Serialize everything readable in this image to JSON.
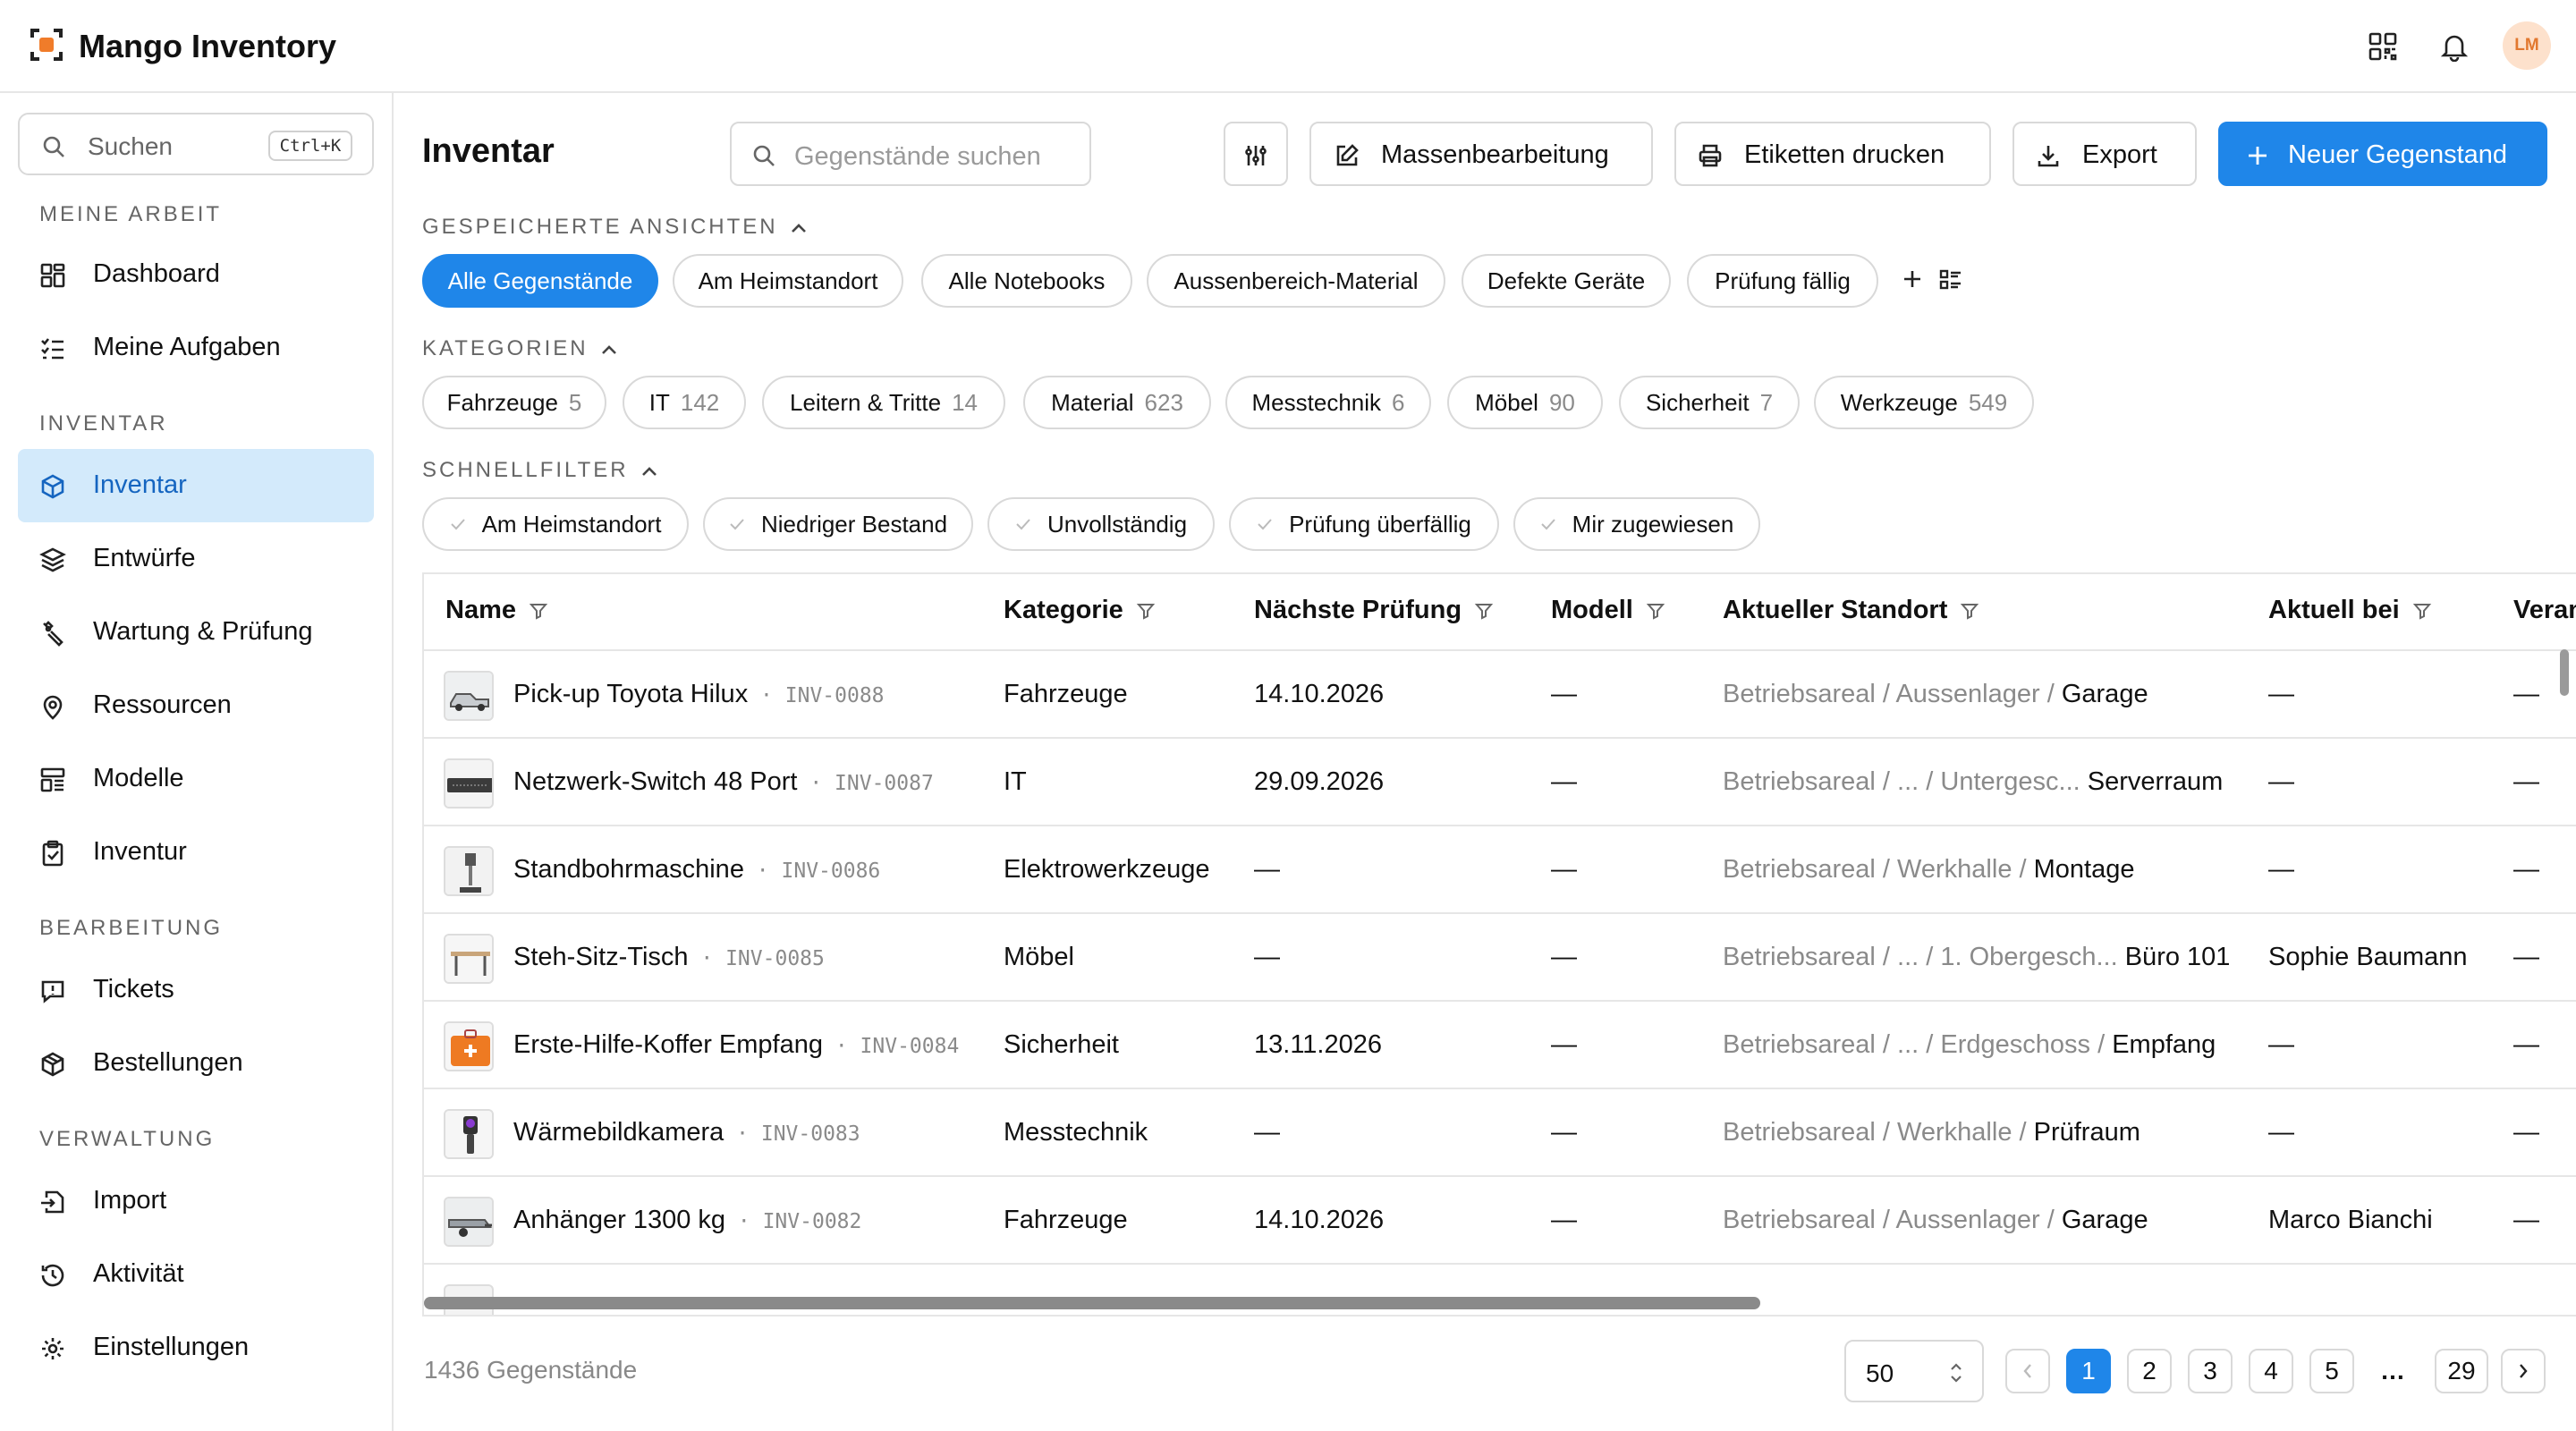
{
  "app": {
    "name": "Mango Inventory",
    "avatar_initials": "LM",
    "accent": "#1f86e9"
  },
  "sidebar": {
    "search_placeholder": "Suchen",
    "shortcut": "Ctrl+K",
    "sections": {
      "work": "MEINE ARBEIT",
      "inventory": "INVENTAR",
      "editing": "BEARBEITUNG",
      "admin": "VERWALTUNG"
    },
    "items": {
      "dashboard": "Dashboard",
      "tasks": "Meine Aufgaben",
      "inventory": "Inventar",
      "drafts": "Entwürfe",
      "maintenance": "Wartung & Prüfung",
      "resources": "Ressourcen",
      "models": "Modelle",
      "stocktake": "Inventur",
      "tickets": "Tickets",
      "orders": "Bestellungen",
      "import": "Import",
      "activity": "Aktivität",
      "settings": "Einstellungen"
    }
  },
  "header": {
    "title": "Inventar",
    "search_placeholder": "Gegenstände suchen",
    "bulk_edit": "Massenbearbeitung",
    "print_labels": "Etiketten drucken",
    "export": "Export",
    "new_item": "Neuer Gegenstand"
  },
  "saved_views": {
    "label": "GESPEICHERTE ANSICHTEN",
    "items": [
      "Alle Gegenstände",
      "Am Heimstandort",
      "Alle Notebooks",
      "Aussenbereich-Material",
      "Defekte Geräte",
      "Prüfung fällig"
    ]
  },
  "categories": {
    "label": "KATEGORIEN",
    "items": [
      {
        "name": "Fahrzeuge",
        "count": "5"
      },
      {
        "name": "IT",
        "count": "142"
      },
      {
        "name": "Leitern & Tritte",
        "count": "14"
      },
      {
        "name": "Material",
        "count": "623"
      },
      {
        "name": "Messtechnik",
        "count": "6"
      },
      {
        "name": "Möbel",
        "count": "90"
      },
      {
        "name": "Sicherheit",
        "count": "7"
      },
      {
        "name": "Werkzeuge",
        "count": "549"
      }
    ]
  },
  "quick_filters": {
    "label": "SCHNELLFILTER",
    "items": [
      "Am Heimstandort",
      "Niedriger Bestand",
      "Unvollständig",
      "Prüfung überfällig",
      "Mir zugewiesen"
    ]
  },
  "table": {
    "columns": [
      "Name",
      "Kategorie",
      "Nächste Prüfung",
      "Modell",
      "Aktueller Standort",
      "Aktuell bei",
      "Veran"
    ],
    "rows": [
      {
        "name": "Pick-up Toyota Hilux",
        "code": "INV-0088",
        "category": "Fahrzeuge",
        "next_check": "14.10.2026",
        "model": "—",
        "location_path": "Betriebsareal / Aussenlager /",
        "location": "Garage",
        "holder": "—",
        "resp": "—"
      },
      {
        "name": "Netzwerk-Switch 48 Port",
        "code": "INV-0087",
        "category": "IT",
        "next_check": "29.09.2026",
        "model": "—",
        "location_path": "Betriebsareal / ... / Untergesc...",
        "location": "Serverraum",
        "holder": "—",
        "resp": "—"
      },
      {
        "name": "Standbohrmaschine",
        "code": "INV-0086",
        "category": "Elektrowerkzeuge",
        "next_check": "—",
        "model": "—",
        "location_path": "Betriebsareal / Werkhalle /",
        "location": "Montage",
        "holder": "—",
        "resp": "—"
      },
      {
        "name": "Steh-Sitz-Tisch",
        "code": "INV-0085",
        "category": "Möbel",
        "next_check": "—",
        "model": "—",
        "location_path": "Betriebsareal / ... / 1. Obergesch...",
        "location": "Büro 101",
        "holder": "Sophie Baumann",
        "resp": "—"
      },
      {
        "name": "Erste-Hilfe-Koffer Empfang",
        "code": "INV-0084",
        "category": "Sicherheit",
        "next_check": "13.11.2026",
        "model": "—",
        "location_path": "Betriebsareal / ... / Erdgeschoss /",
        "location": "Empfang",
        "holder": "—",
        "resp": "—"
      },
      {
        "name": "Wärmebildkamera",
        "code": "INV-0083",
        "category": "Messtechnik",
        "next_check": "—",
        "model": "—",
        "location_path": "Betriebsareal / Werkhalle /",
        "location": "Prüfraum",
        "holder": "—",
        "resp": "—"
      },
      {
        "name": "Anhänger 1300 kg",
        "code": "INV-0082",
        "category": "Fahrzeuge",
        "next_check": "14.10.2026",
        "model": "—",
        "location_path": "Betriebsareal / Aussenlager /",
        "location": "Garage",
        "holder": "Marco Bianchi",
        "resp": "—"
      }
    ]
  },
  "footer": {
    "total": "1436 Gegenstände",
    "page_size": "50",
    "pages": [
      "1",
      "2",
      "3",
      "4",
      "5",
      "…",
      "29"
    ],
    "current_page": "1"
  }
}
